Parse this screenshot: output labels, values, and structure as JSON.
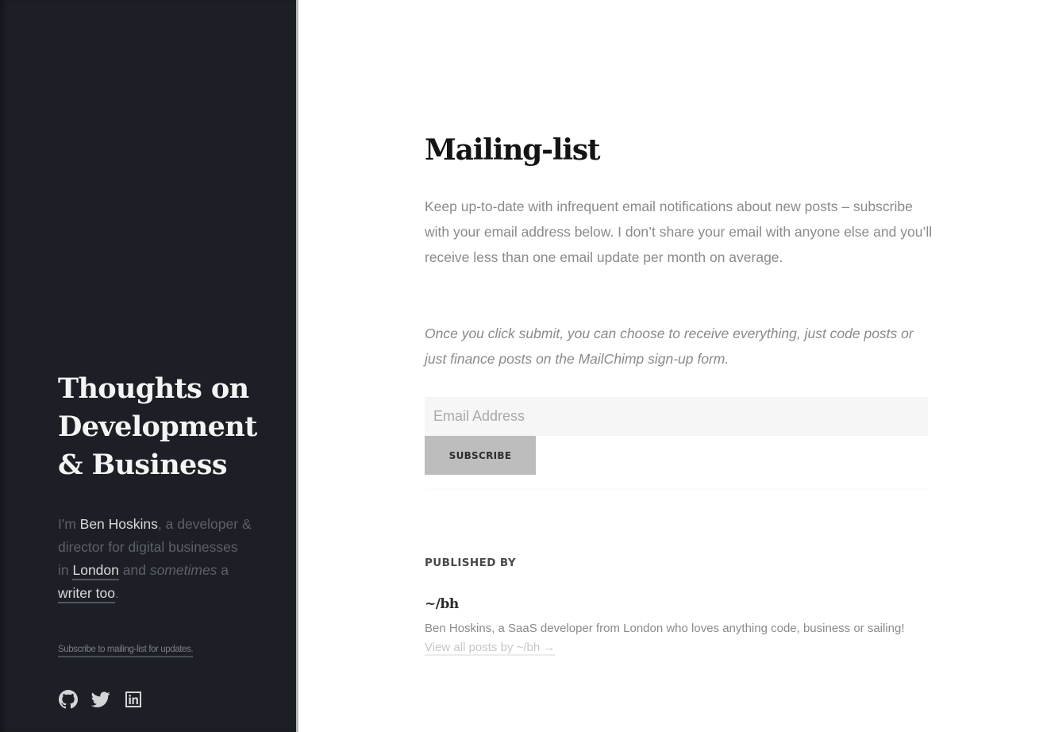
{
  "sidebar": {
    "site_title": "Thoughts on Development & Business",
    "bio": {
      "prefix": "I'm ",
      "name": "Ben Hoskins",
      "middle": ", a developer & director for digital businesses in ",
      "location_link": "London",
      "and": " and ",
      "sometimes": "sometimes",
      "a": " a ",
      "writer_link": "writer too",
      "end": "."
    },
    "subscribe_note": "Subscribe to mailing-list for updates.",
    "social": [
      {
        "icon": "github-icon",
        "label": "GitHub"
      },
      {
        "icon": "twitter-icon",
        "label": "Twitter"
      },
      {
        "icon": "linkedin-icon",
        "label": "LinkedIn"
      }
    ]
  },
  "main": {
    "title": "Mailing-list",
    "intro": "Keep up-to-date with infrequent email notifications about new posts – subscribe with your email address below. I don’t share your email with anyone else and you’ll receive less than one email update per month on average.",
    "note": "Once you click submit, you can choose to receive everything, just code posts or just finance posts on the MailChimp sign-up form.",
    "form": {
      "email_placeholder": "Email Address",
      "email_value": "",
      "subscribe_label": "Subscribe"
    },
    "author": {
      "heading": "Published by",
      "name": "~/bh",
      "bio": "Ben Hoskins, a SaaS developer from London who loves anything code, business or sailing! ",
      "view_all": "View all posts by ~/bh →"
    }
  },
  "colors": {
    "sidebar_bg": "#1d1f26",
    "sidebar_border": "#b8b8b8",
    "button_bg": "#bdbdbd",
    "input_bg": "#f6f6f6"
  }
}
